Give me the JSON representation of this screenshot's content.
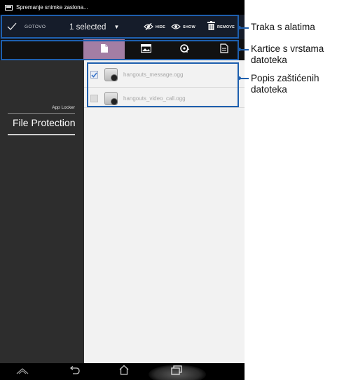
{
  "statusbar": {
    "title": "Spremanje snimke zaslona..."
  },
  "actionbar": {
    "done_label": "GOTOVO",
    "selection_label": "1 selected",
    "hide_label": "HIDE",
    "show_label": "SHOW",
    "remove_label": "REMOVE"
  },
  "tabs": [
    {
      "icon": "file-icon",
      "selected": true
    },
    {
      "icon": "image-icon",
      "selected": false
    },
    {
      "icon": "music-icon",
      "selected": false
    },
    {
      "icon": "document-icon",
      "selected": false
    }
  ],
  "sidebar": {
    "section_label": "App Locker",
    "active_item": "File Protection"
  },
  "files": [
    {
      "name": "hangouts_message.ogg",
      "checked": true
    },
    {
      "name": "hangouts_video_call.ogg",
      "checked": false
    }
  ],
  "navbar": {
    "buttons": [
      "back-icon",
      "home-icon",
      "recent-apps-icon"
    ]
  },
  "callouts": {
    "toolbar": "Traka s alatima",
    "tabs_line1": "Kartice s vrstama",
    "tabs_line2": "datoteka",
    "list_line1": "Popis zaštićenih",
    "list_line2": "datoteka"
  },
  "colors": {
    "action_bar": "#151c2a",
    "selected_tab": "#a37ea4",
    "sidebar": "#2d2d2d",
    "callout": "#1e5fae"
  }
}
